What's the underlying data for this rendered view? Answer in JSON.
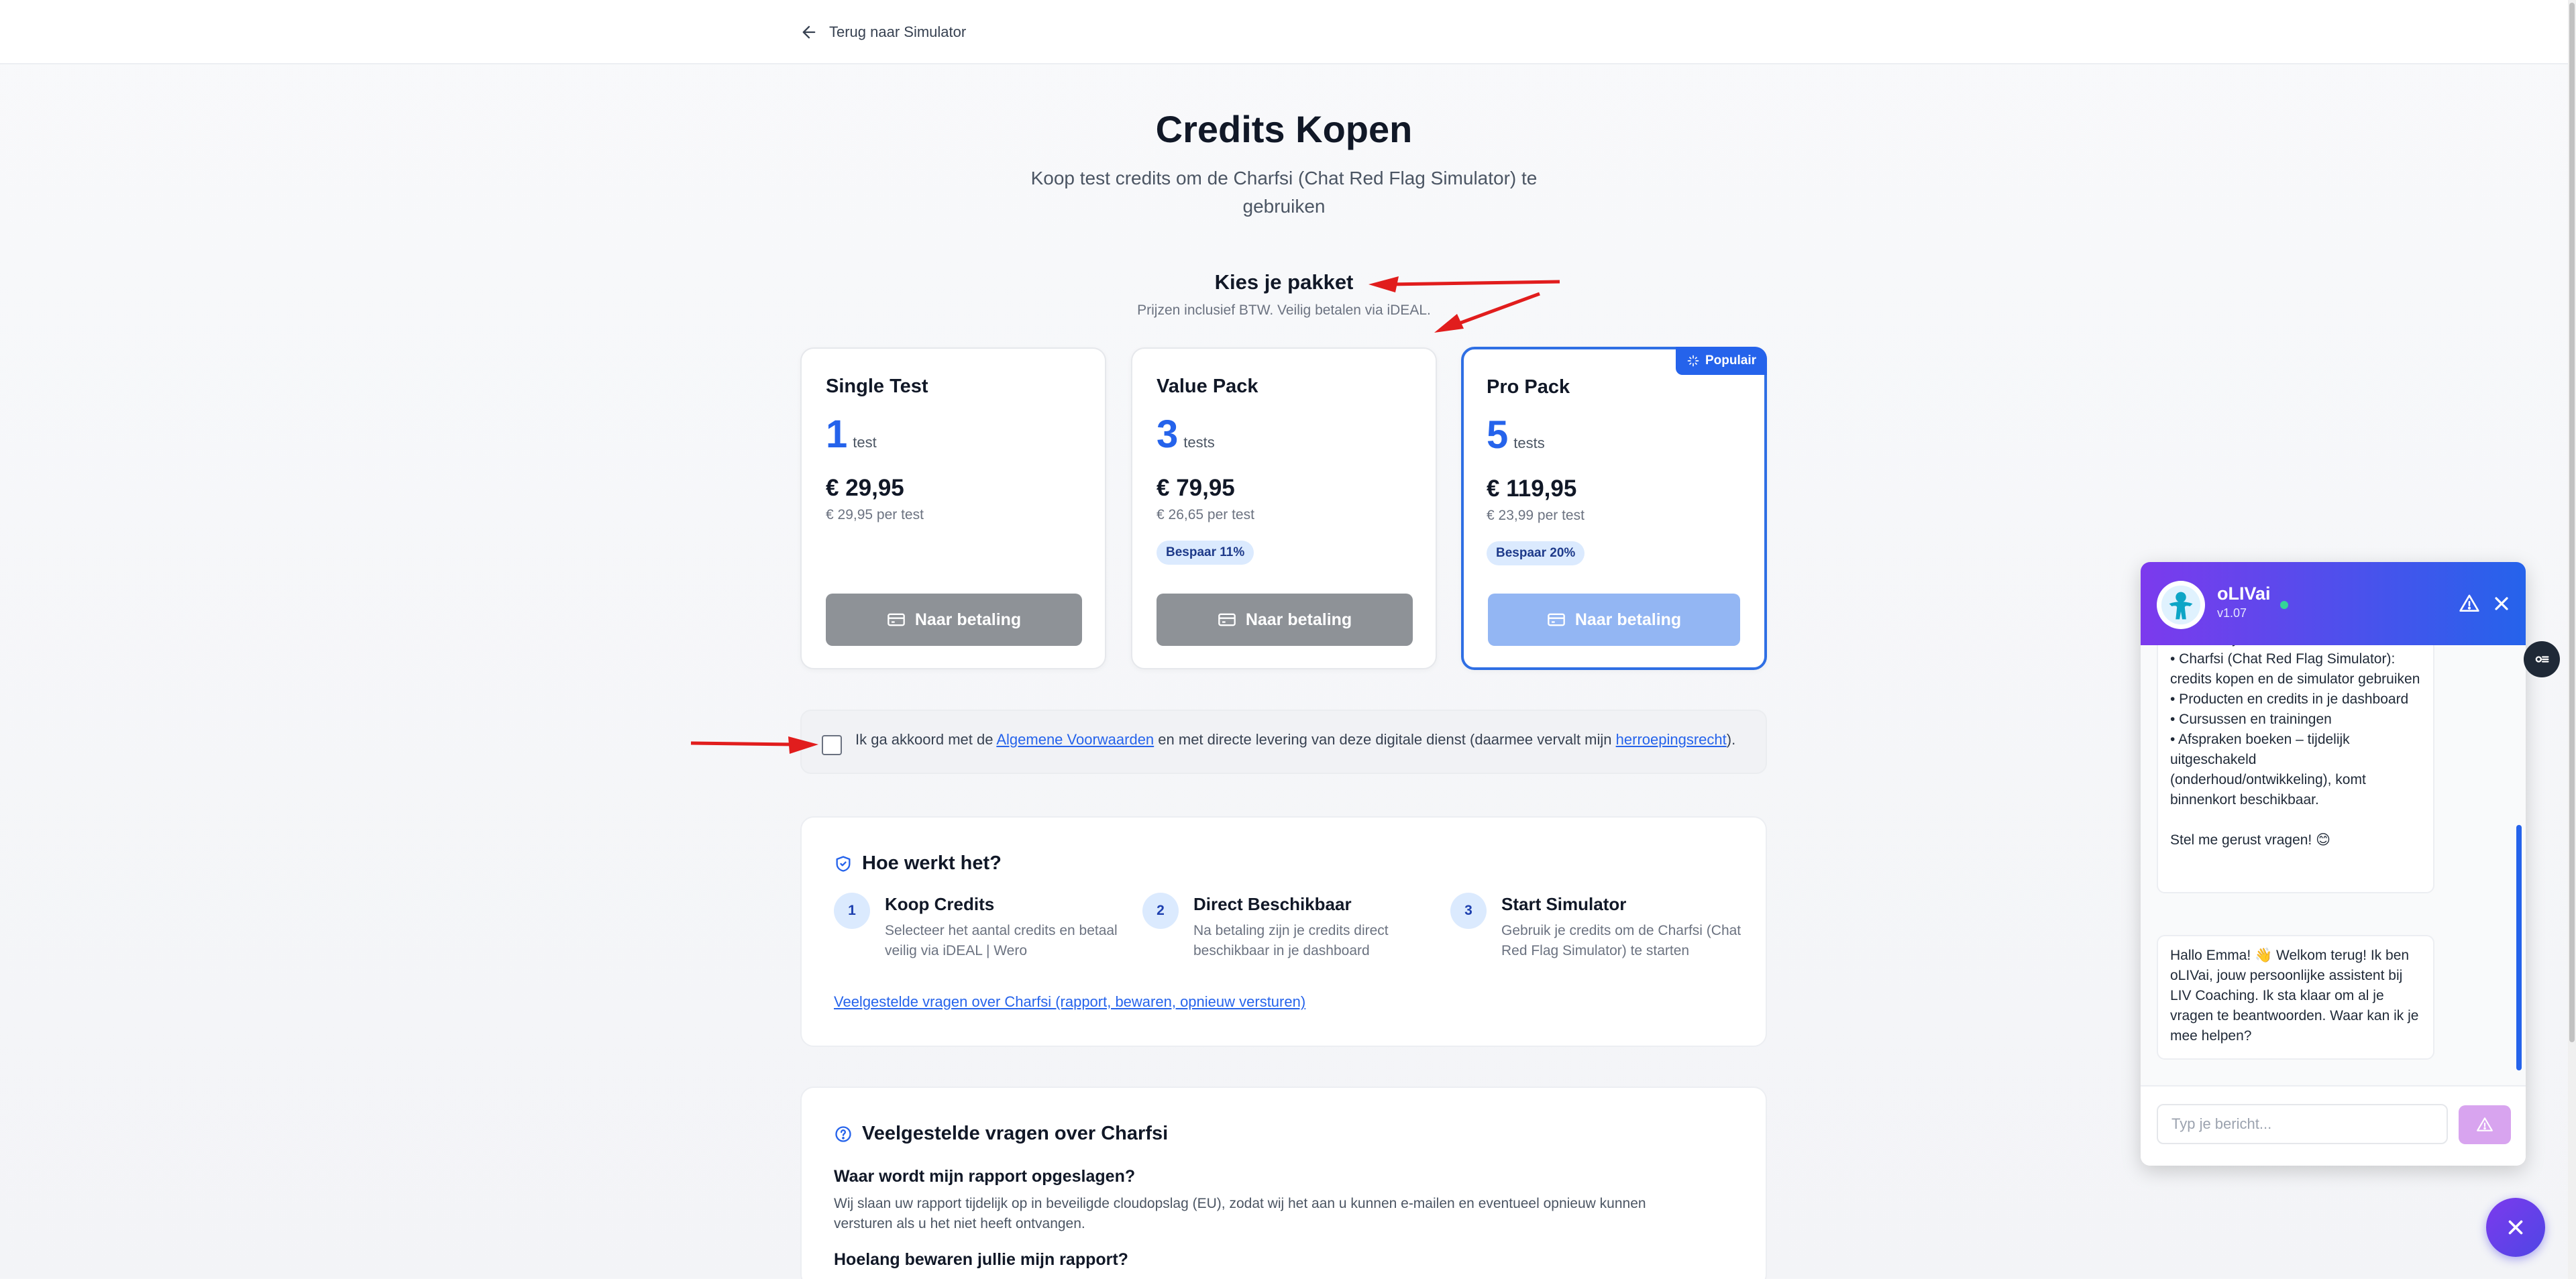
{
  "nav": {
    "back_label": "Terug naar Simulator"
  },
  "header": {
    "title": "Credits Kopen",
    "subtitle": "Koop test credits om de Charfsi (Chat Red Flag Simulator) te gebruiken"
  },
  "packages_section": {
    "title": "Kies je pakket",
    "subtitle": "Prijzen inclusief BTW. Veilig betalen via iDEAL."
  },
  "packages": [
    {
      "name": "Single Test",
      "count": "1",
      "unit": "test",
      "price": "€ 29,95",
      "per_test": "€ 29,95 per test",
      "save": "",
      "button": "Naar betaling"
    },
    {
      "name": "Value Pack",
      "count": "3",
      "unit": "tests",
      "price": "€ 79,95",
      "per_test": "€ 26,65 per test",
      "save": "Bespaar 11%",
      "button": "Naar betaling"
    },
    {
      "name": "Pro Pack",
      "count": "5",
      "unit": "tests",
      "price": "€ 119,95",
      "per_test": "€ 23,99 per test",
      "save": "Bespaar 20%",
      "button": "Naar betaling",
      "badge": "Populair"
    }
  ],
  "agreement": {
    "text_before": "Ik ga akkoord met de ",
    "terms_link": "Algemene Voorwaarden",
    "text_middle": " en met directe levering van deze digitale dienst (daarmee vervalt mijn ",
    "withdrawal_link": "herroepingsrecht",
    "text_after": ")."
  },
  "how_it_works": {
    "title": "Hoe werkt het?",
    "steps": [
      {
        "num": "1",
        "title": "Koop Credits",
        "desc": "Selecteer het aantal credits en betaal veilig via iDEAL | Wero"
      },
      {
        "num": "2",
        "title": "Direct Beschikbaar",
        "desc": "Na betaling zijn je credits direct beschikbaar in je dashboard"
      },
      {
        "num": "3",
        "title": "Start Simulator",
        "desc": "Gebruik je credits om de Charfsi (Chat Red Flag Simulator) te starten"
      }
    ],
    "faq_link": "Veelgestelde vragen over Charfsi (rapport, bewaren, opnieuw versturen)"
  },
  "faq": {
    "title": "Veelgestelde vragen over Charfsi",
    "q1": "Waar wordt mijn rapport opgeslagen?",
    "a1": "Wij slaan uw rapport tijdelijk op in beveiligde cloudopslag (EU), zodat wij het aan u kunnen e-mailen en eventueel opnieuw kunnen versturen als u het niet heeft ontvangen.",
    "q2": "Hoelang bewaren jullie mijn rapport?"
  },
  "chat": {
    "name": "oLIVai",
    "version": "v1.07",
    "message1": "LIV – wat je hier kunt:\n• Charfsi (Chat Red Flag Simulator): credits kopen en de simulator gebruiken\n• Producten en credits in je dashboard\n• Cursussen en trainingen\n• Afspraken boeken – tijdelijk uitgeschakeld (onderhoud/ontwikkeling), komt binnenkort beschikbaar.\n\nStel me gerust vragen! 😊",
    "message2": "Hallo Emma! 👋 Welkom terug! Ik ben oLIVai, jouw persoonlijke assistent bij LIV Coaching. Ik sta klaar om al je vragen te beantwoorden. Waar kan ik je mee helpen?",
    "input_placeholder": "Typ je bericht..."
  },
  "colors": {
    "accent": "#2563eb",
    "chat_gradient_start": "#7c3aed",
    "chat_gradient_end": "#2563eb",
    "button_disabled": "#8e9297",
    "annotation_arrow": "#e11d1d"
  },
  "icons": [
    "arrow-left-icon",
    "credit-card-icon",
    "sparkle-icon",
    "shield-check-icon",
    "help-circle-icon",
    "warning-icon",
    "close-icon",
    "send-icon",
    "tools-icon"
  ]
}
